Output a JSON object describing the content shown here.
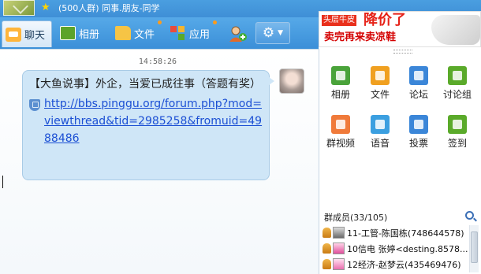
{
  "window": {
    "group_title": "(500人群) 同事.朋友-同学"
  },
  "toolbar": {
    "tabs": [
      {
        "label": "聊天",
        "icon": "chat-icon"
      },
      {
        "label": "相册",
        "icon": "album-icon"
      },
      {
        "label": "文件",
        "icon": "folder-icon"
      },
      {
        "label": "应用",
        "icon": "apps-icon"
      }
    ],
    "add_member_icon": "add-member-icon",
    "settings_icon": "gear-icon"
  },
  "ad": {
    "tag": "头层牛皮",
    "headline": "降价了",
    "subline": "卖完再来卖凉鞋"
  },
  "chat": {
    "timestamp": "14:58:26",
    "message": {
      "title": "【大鱼说事】外企，当爱已成往事（答题有奖）",
      "link": "http://bbs.pinggu.org/forum.php?mod=viewthread&tid=2985258&fromuid=4988486"
    }
  },
  "side": {
    "apps": [
      {
        "label": "相册",
        "color": "#4aa33a"
      },
      {
        "label": "文件",
        "color": "#f0a020"
      },
      {
        "label": "论坛",
        "color": "#3b86d8"
      },
      {
        "label": "讨论组",
        "color": "#5aaa2a"
      },
      {
        "label": "群视频",
        "color": "#f07a3a"
      },
      {
        "label": "语音",
        "color": "#3b9fe0"
      },
      {
        "label": "投票",
        "color": "#3b86d8"
      },
      {
        "label": "签到",
        "color": "#5aaa2a"
      }
    ],
    "members_header": "群成员(33/105)",
    "members": [
      {
        "name": "11-工管-陈国栋(748644578)"
      },
      {
        "name": "10信电 张婷<desting.8578..."
      },
      {
        "name": "12经济-赵梦云(435469476)"
      }
    ]
  }
}
